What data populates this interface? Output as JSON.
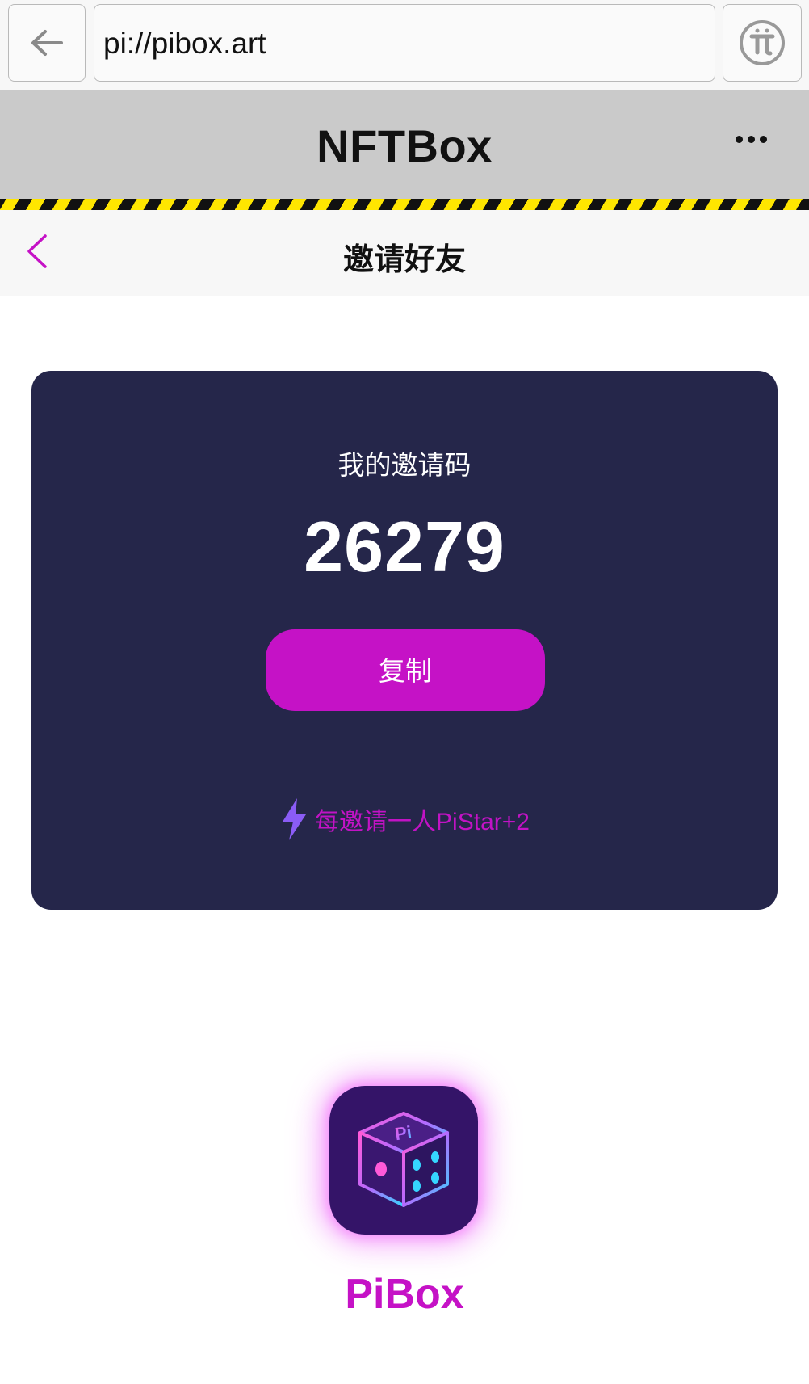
{
  "browser": {
    "url": "pi://pibox.art",
    "back_icon": "arrow-left-icon",
    "pi_icon": "pi-network-icon"
  },
  "app": {
    "title": "NFTBox",
    "menu_icon": "more-icon"
  },
  "page": {
    "title": "邀请好友",
    "back_icon": "chevron-left-icon"
  },
  "invite": {
    "label": "我的邀请码",
    "code": "26279",
    "copy_label": "复制",
    "reward_text": "每邀请一人PiStar+2",
    "reward_icon": "lightning-icon"
  },
  "brand": {
    "name": "PiBox",
    "logo_icon": "dice-logo-icon"
  },
  "colors": {
    "accent": "#c512c6",
    "card_bg": "#25264a",
    "header_bg": "#cacaca",
    "hazard_yellow": "#ffe600"
  }
}
